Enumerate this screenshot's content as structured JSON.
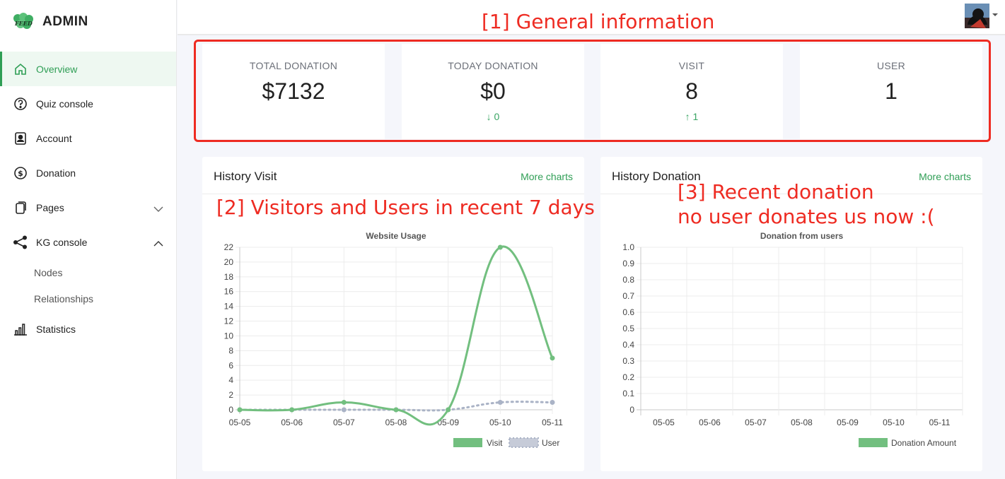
{
  "app": {
    "title": "ADMIN"
  },
  "sidebar": {
    "items": [
      {
        "label": "Overview",
        "icon": "home-icon",
        "active": true
      },
      {
        "label": "Quiz console",
        "icon": "question-circle-icon"
      },
      {
        "label": "Account",
        "icon": "account-icon"
      },
      {
        "label": "Donation",
        "icon": "dollar-circle-icon"
      },
      {
        "label": "Pages",
        "icon": "pages-icon",
        "caret": "chevron-down-icon"
      },
      {
        "label": "KG console",
        "icon": "share-icon",
        "caret": "chevron-up-icon"
      }
    ],
    "subitems": [
      {
        "label": "Nodes"
      },
      {
        "label": "Relationships"
      }
    ],
    "stats_item": {
      "label": "Statistics",
      "icon": "bar-chart-icon"
    }
  },
  "annotations": {
    "a1": "[1] General information",
    "a2": "[2] Visitors and Users in recent 7 days",
    "a3_line1": "[3] Recent donation",
    "a3_line2": "no user donates us now :("
  },
  "stats": [
    {
      "label": "TOTAL DONATION",
      "value": "$7132",
      "trend": ""
    },
    {
      "label": "TODAY DONATION",
      "value": "$0",
      "trend": "↓ 0"
    },
    {
      "label": "VISIT",
      "value": "8",
      "trend": "↑ 1"
    },
    {
      "label": "USER",
      "value": "1",
      "trend": ""
    }
  ],
  "cards": {
    "visit": {
      "title": "History Visit",
      "link": "More charts"
    },
    "donation": {
      "title": "History Donation",
      "link": "More charts"
    }
  },
  "colors": {
    "accent": "#2f9e55",
    "visit": "#72bf7f",
    "user": "#aab3c6",
    "annotation": "#ee2b22"
  },
  "chart_data": [
    {
      "type": "line",
      "title": "Website Usage",
      "categories": [
        "05-05",
        "05-06",
        "05-07",
        "05-08",
        "05-09",
        "05-10",
        "05-11"
      ],
      "series": [
        {
          "name": "Visit",
          "values": [
            0,
            0,
            1,
            0,
            0,
            22,
            7
          ]
        },
        {
          "name": "User",
          "values": [
            0,
            0,
            0,
            0,
            0,
            1,
            1
          ]
        }
      ],
      "ylim": [
        0,
        22
      ],
      "yticks": [
        0,
        2,
        4,
        6,
        8,
        10,
        12,
        14,
        16,
        18,
        20,
        22
      ],
      "legend": "bottom-right",
      "grid": true
    },
    {
      "type": "bar",
      "title": "Donation from users",
      "categories": [
        "05-05",
        "05-06",
        "05-07",
        "05-08",
        "05-09",
        "05-10",
        "05-11"
      ],
      "series": [
        {
          "name": "Donation Amount",
          "values": [
            0,
            0,
            0,
            0,
            0,
            0,
            0
          ]
        }
      ],
      "ylim": [
        0,
        1.0
      ],
      "yticks": [
        "0",
        "0.1",
        "0.2",
        "0.3",
        "0.4",
        "0.5",
        "0.6",
        "0.7",
        "0.8",
        "0.9",
        "1.0"
      ],
      "legend": "bottom-right",
      "grid": true
    }
  ]
}
